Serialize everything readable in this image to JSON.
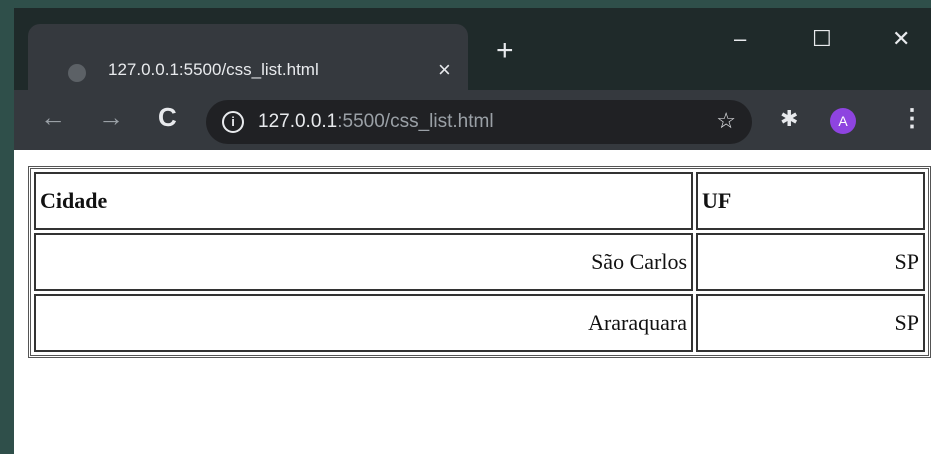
{
  "browser": {
    "tab": {
      "title": "127.0.0.1:5500/css_list.html",
      "close_label": "×"
    },
    "new_tab_label": "+",
    "window_controls": {
      "minimize": "–",
      "maximize": "☐",
      "close": "✕"
    },
    "nav": {
      "back": "←",
      "forward": "→",
      "reload": "C"
    },
    "address": {
      "host": "127.0.0.1",
      "rest": ":5500/css_list.html"
    },
    "profile_initial": "A"
  },
  "table": {
    "headers": [
      "Cidade",
      "UF"
    ],
    "rows": [
      [
        "São Carlos",
        "SP"
      ],
      [
        "Araraquara",
        "SP"
      ]
    ]
  }
}
